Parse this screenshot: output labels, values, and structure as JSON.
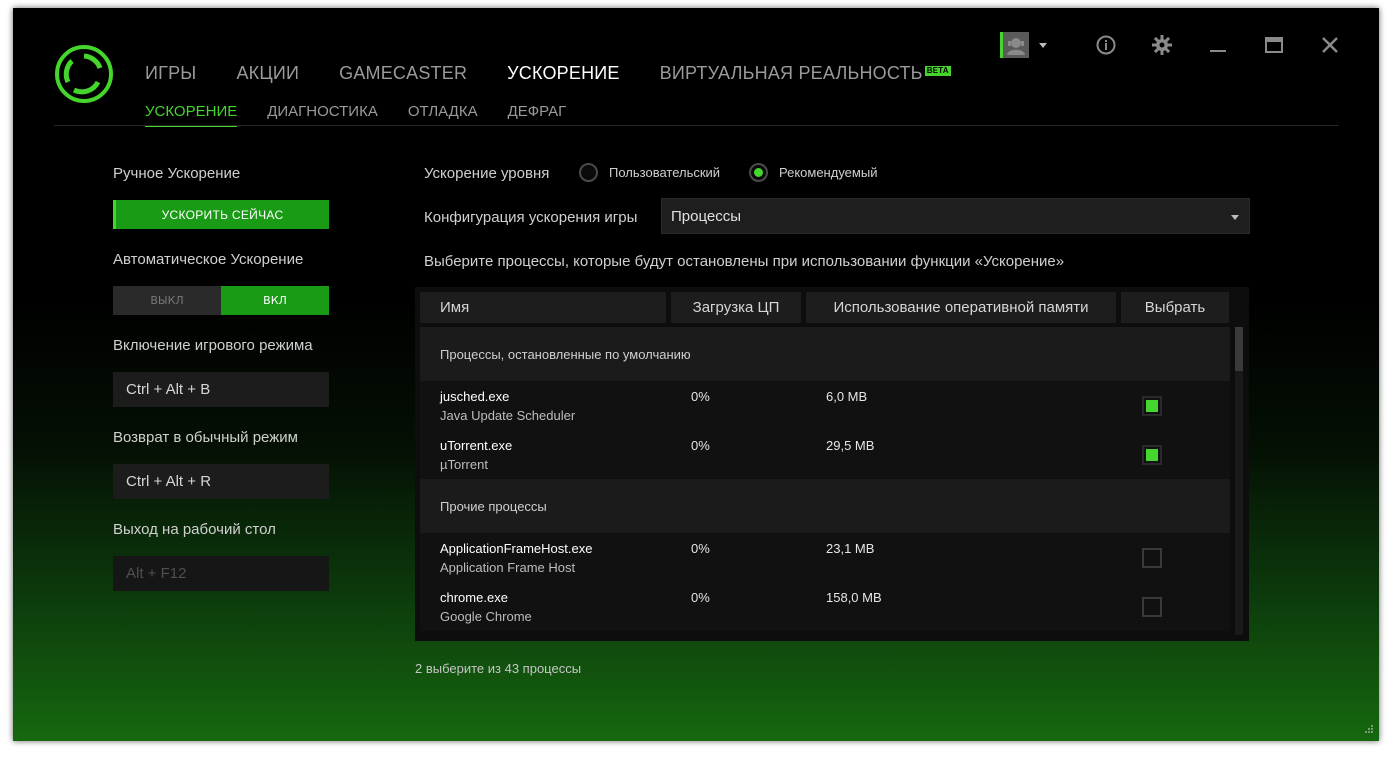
{
  "nav": {
    "main_tabs": [
      {
        "label": "ИГРЫ"
      },
      {
        "label": "АКЦИИ"
      },
      {
        "label": "GAMECASTER"
      },
      {
        "label": "УСКОРЕНИЕ"
      },
      {
        "label": "ВИРТУАЛЬНАЯ РЕАЛЬНОСТЬ"
      }
    ],
    "beta_badge": "BETA",
    "active_main_tab": "УСКОРЕНИЕ",
    "sub_tabs": [
      {
        "label": "УСКОРЕНИЕ"
      },
      {
        "label": "ДИАГНОСТИКА"
      },
      {
        "label": "ОТЛАДКА"
      },
      {
        "label": "ДЕФРАГ"
      }
    ],
    "active_sub_tab": "УСКОРЕНИЕ"
  },
  "window_controls": {
    "icons": [
      "avatar-icon",
      "info-icon",
      "gear-icon",
      "minimize-icon",
      "maximize-icon",
      "close-icon"
    ]
  },
  "left": {
    "manual_label": "Ручное Ускорение",
    "boost_now": "УСКОРИТЬ СЕЙЧАС",
    "auto_label": "Автоматическое Ускорение",
    "toggle_off": "ВЫКЛ",
    "toggle_on": "ВКЛ",
    "toggle_state": "on",
    "game_mode_label": "Включение игрового режима",
    "game_mode_key": "Ctrl + Alt + B",
    "normal_mode_label": "Возврат в обычный режим",
    "normal_mode_key": "Ctrl + Alt + R",
    "desktop_label": "Выход на рабочий стол",
    "desktop_key": "Alt + F12"
  },
  "right": {
    "level_label": "Ускорение уровня",
    "radio_custom": "Пользовательский",
    "radio_recommended": "Рекомендуемый",
    "selected_radio": "recommended",
    "config_label": "Конфигурация ускорения игры",
    "config_value": "Процессы",
    "instruction": "Выберите процессы, которые будут остановлены при использовании функции «Ускорение»"
  },
  "table": {
    "columns": [
      "Имя",
      "Загрузка ЦП",
      "Использование оперативной памяти",
      "Выбрать"
    ],
    "groups": [
      {
        "title": "Процессы, остановленные по умолчанию",
        "rows": [
          {
            "name": "jusched.exe",
            "desc": "Java Update Scheduler",
            "cpu": "0%",
            "mem": "6,0 MB",
            "checked": true
          },
          {
            "name": "uTorrent.exe",
            "desc": "µTorrent",
            "cpu": "0%",
            "mem": "29,5 MB",
            "checked": true
          }
        ]
      },
      {
        "title": "Прочие процессы",
        "rows": [
          {
            "name": "ApplicationFrameHost.exe",
            "desc": "Application Frame Host",
            "cpu": "0%",
            "mem": "23,1 MB",
            "checked": false
          },
          {
            "name": "chrome.exe",
            "desc": "Google Chrome",
            "cpu": "0%",
            "mem": "158,0 MB",
            "checked": false
          }
        ]
      }
    ]
  },
  "footer": {
    "selection_summary": "2 выберите из 43 процессы"
  },
  "colors": {
    "accent": "#44d62c",
    "button_green": "#1a9b16"
  }
}
